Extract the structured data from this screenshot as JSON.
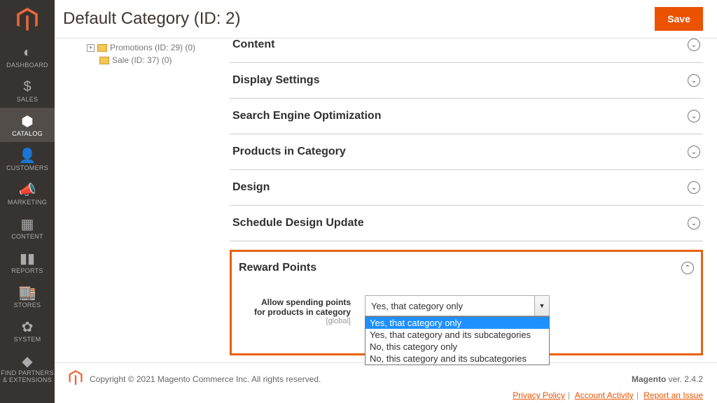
{
  "header": {
    "title": "Default Category (ID: 2)",
    "save": "Save"
  },
  "nav": {
    "items": [
      {
        "icon": "◐",
        "label": "DASHBOARD"
      },
      {
        "icon": "$",
        "label": "SALES"
      },
      {
        "icon": "⬢",
        "label": "CATALOG"
      },
      {
        "icon": "👤",
        "label": "CUSTOMERS"
      },
      {
        "icon": "📣",
        "label": "MARKETING"
      },
      {
        "icon": "▦",
        "label": "CONTENT"
      },
      {
        "icon": "▮▮",
        "label": "REPORTS"
      },
      {
        "icon": "🏬",
        "label": "STORES"
      },
      {
        "icon": "✿",
        "label": "SYSTEM"
      },
      {
        "icon": "◆",
        "label": "FIND PARTNERS\n& EXTENSIONS"
      }
    ]
  },
  "tree": {
    "items": [
      {
        "label": "Promotions (ID: 29) (0)",
        "expand": "+"
      },
      {
        "label": "Sale (ID: 37) (0)"
      }
    ]
  },
  "panels": [
    {
      "title": "Content",
      "chev": "⌄"
    },
    {
      "title": "Display Settings",
      "chev": "⌄"
    },
    {
      "title": "Search Engine Optimization",
      "chev": "⌄"
    },
    {
      "title": "Products in Category",
      "chev": "⌄"
    },
    {
      "title": "Design",
      "chev": "⌄"
    },
    {
      "title": "Schedule Design Update",
      "chev": "⌄"
    }
  ],
  "reward": {
    "title": "Reward Points",
    "chev": "⌃",
    "field_label_1": "Allow spending points",
    "field_label_2": "for products in category",
    "scope": "[global]",
    "selected": "Yes, that category only",
    "options": [
      "Yes, that category only",
      "Yes, that category and its subcategories",
      "No, this category only",
      "No, this category and its subcategories"
    ]
  },
  "footer": {
    "copyright": "Copyright © 2021 Magento Commerce Inc. All rights reserved.",
    "product": "Magento",
    "version": " ver. 2.4.2",
    "links": [
      "Privacy Policy",
      "Account Activity",
      "Report an Issue"
    ]
  }
}
